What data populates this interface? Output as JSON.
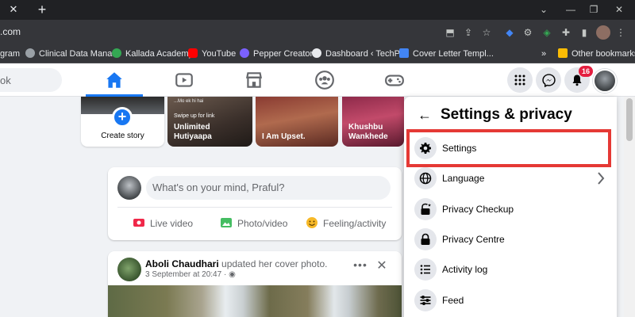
{
  "browser": {
    "url": ".com",
    "bookmarks": [
      {
        "label": "gram",
        "color": "#e1306c"
      },
      {
        "label": "Clinical Data Mana...",
        "color": "#9aa0a6"
      },
      {
        "label": "Kallada Academy",
        "color": "#34a853"
      },
      {
        "label": "YouTube",
        "color": "#ff0000"
      },
      {
        "label": "Pepper Creators",
        "color": "#7b61ff"
      },
      {
        "label": "Dashboard ‹ TechP...",
        "color": "#e8eaed"
      },
      {
        "label": "Cover Letter Templ...",
        "color": "#4285f4"
      }
    ],
    "overflow": "»",
    "other_bookmarks": "Other bookmarks"
  },
  "header": {
    "search_placeholder": "ok",
    "notification_count": "16",
    "accent": "#1877f2"
  },
  "stories": {
    "create_label": "Create story",
    "items": [
      {
        "text": "Unlimited Hutiyaapa",
        "overlay": "Swipe up for link",
        "overlay_top": "...Mo ek hi hai"
      },
      {
        "text": "I Am Upset."
      },
      {
        "text": "Khushbu Wankhede"
      }
    ]
  },
  "composer": {
    "placeholder": "What's on your mind, Praful?",
    "actions": [
      {
        "label": "Live video",
        "icon": "live-video-icon",
        "color": "#f02849"
      },
      {
        "label": "Photo/video",
        "icon": "photo-icon",
        "color": "#45bd62"
      },
      {
        "label": "Feeling/activity",
        "icon": "feeling-icon",
        "color": "#f7b928"
      }
    ]
  },
  "post": {
    "author": "Aboli Chaudhari",
    "action": "updated her cover photo.",
    "time": "3 September at 20:47 ·"
  },
  "menu": {
    "title": "Settings & privacy",
    "items": [
      {
        "label": "Settings",
        "icon": "gear-icon"
      },
      {
        "label": "Language",
        "icon": "globe-icon"
      },
      {
        "label": "Privacy Checkup",
        "icon": "lock-star-icon"
      },
      {
        "label": "Privacy Centre",
        "icon": "lock-icon"
      },
      {
        "label": "Activity log",
        "icon": "list-icon"
      },
      {
        "label": "Feed",
        "icon": "sliders-icon"
      }
    ],
    "highlight_color": "#e53935"
  }
}
